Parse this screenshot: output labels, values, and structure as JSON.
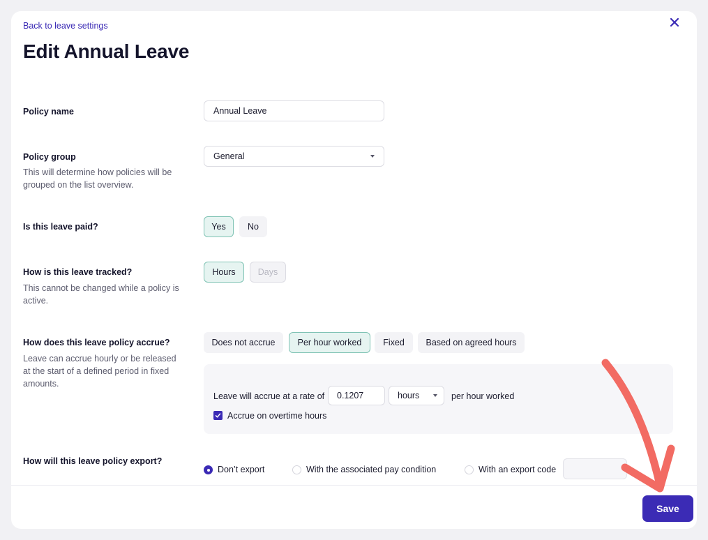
{
  "header": {
    "back_link": "Back to leave settings",
    "title": "Edit Annual Leave",
    "close_icon": "close-icon"
  },
  "policy_name": {
    "label": "Policy name",
    "value": "Annual Leave"
  },
  "policy_group": {
    "label": "Policy group",
    "helper": "This will determine how policies will be grouped on the list overview.",
    "selected": "General"
  },
  "paid": {
    "label": "Is this leave paid?",
    "options": [
      "Yes",
      "No"
    ],
    "selected": "Yes"
  },
  "tracked": {
    "label": "How is this leave tracked?",
    "helper": "This cannot be changed while a policy is active.",
    "options": [
      "Hours",
      "Days"
    ],
    "selected": "Hours",
    "disabled": "Days"
  },
  "accrue": {
    "label": "How does this leave policy accrue?",
    "helper": "Leave can accrue hourly or be released at the start of a defined period in fixed amounts.",
    "options": [
      "Does not accrue",
      "Per hour worked",
      "Fixed",
      "Based on agreed hours"
    ],
    "selected": "Per hour worked",
    "rate_prefix": "Leave will accrue at a rate of",
    "rate_value": "0.1207",
    "rate_unit": "hours",
    "rate_suffix": "per hour worked",
    "overtime_label": "Accrue on overtime hours",
    "overtime_checked": true
  },
  "export": {
    "label": "How will this leave policy export?",
    "options": [
      "Don’t export",
      "With the associated pay condition",
      "With an export code"
    ],
    "selected": "Don’t export",
    "export_code_value": ""
  },
  "footer": {
    "save_label": "Save"
  },
  "colors": {
    "accent": "#3b2bb5",
    "selected_chip_bg": "#e6f4f1",
    "selected_chip_border": "#7fc3b4",
    "annotation_arrow": "#f26b63"
  }
}
